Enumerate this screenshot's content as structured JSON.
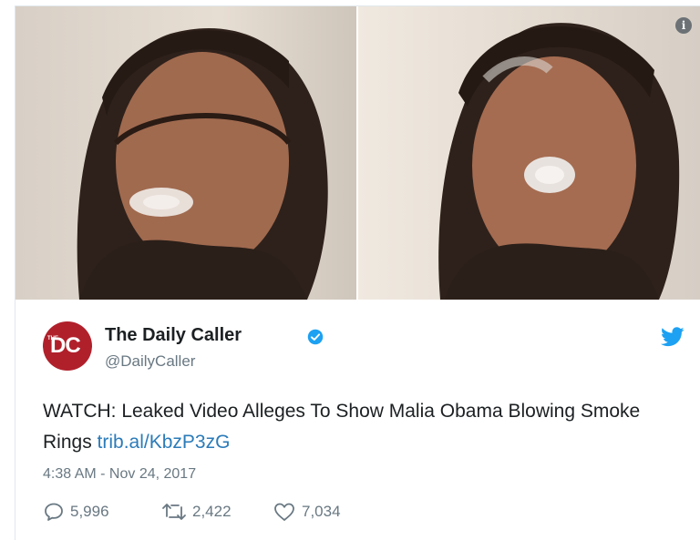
{
  "tweet": {
    "author_name": "The Daily Caller",
    "handle": "@DailyCaller",
    "avatar_text": "DC",
    "avatar_small": "THE",
    "text_main": "WATCH: Leaked Video Alleges To Show Malia Obama Blowing Smoke Rings ",
    "link_text": "trib.al/KbzP3zG",
    "timestamp": "4:38 AM - Nov 24, 2017",
    "info_label": "i",
    "stats": {
      "replies": "5,996",
      "retweets": "2,422",
      "likes": "7,034"
    }
  },
  "colors": {
    "link": "#2b7bb9",
    "verified": "#1da1f2",
    "twitter_bird": "#1da1f2",
    "avatar_bg": "#b0202b"
  },
  "icons": [
    "info-icon",
    "verified-badge-icon",
    "twitter-bird-icon",
    "reply-icon",
    "retweet-icon",
    "like-icon"
  ]
}
